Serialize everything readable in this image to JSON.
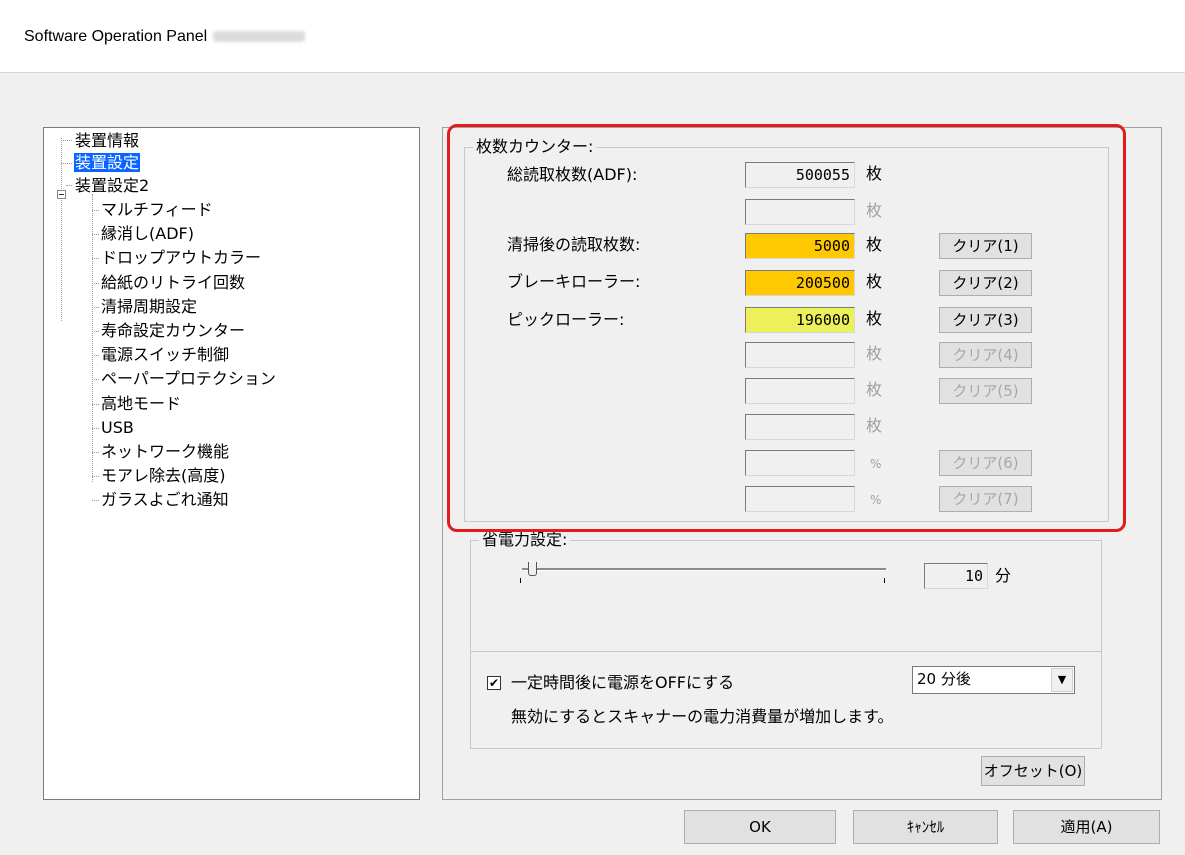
{
  "window": {
    "title": "Software Operation Panel"
  },
  "tree": {
    "items": [
      "装置情報",
      "装置設定",
      "装置設定2",
      "マルチフィード",
      "縁消し(ADF)",
      "ドロップアウトカラー",
      "給紙のリトライ回数",
      "清掃周期設定",
      "寿命設定カウンター",
      "電源スイッチ制御",
      "ペーパープロテクション",
      "高地モード",
      "USB",
      "ネットワーク機能",
      "モアレ除去(高度)",
      "ガラスよごれ通知"
    ],
    "selected": "装置設定"
  },
  "counter": {
    "group_title": "枚数カウンター:",
    "total_label": "総読取枚数(ADF):",
    "cleaning_label": "清掃後の読取枚数:",
    "brake_label": "ブレーキローラー:",
    "pick_label": "ピックローラー:",
    "values": [
      "500055",
      "",
      "5000",
      "200500",
      "196000",
      "",
      "",
      "",
      "",
      ""
    ],
    "units": [
      "枚",
      "枚",
      "枚",
      "枚",
      "枚",
      "枚",
      "枚",
      "枚",
      "%",
      "%"
    ],
    "clear_buttons": [
      "クリア(1)",
      "クリア(2)",
      "クリア(3)",
      "クリア(4)",
      "クリア(5)",
      "クリア(6)",
      "クリア(7)"
    ],
    "colors": {
      "cleaning": "#ffc800",
      "brake": "#ffc800",
      "pick": "#ecf05a"
    }
  },
  "power": {
    "group_title": "省電力設定:",
    "minutes": "10",
    "unit": "分",
    "auto_off_label": "一定時間後に電源をOFFにする",
    "auto_off_checked": true,
    "auto_off_value": "20 分後",
    "note": "無効にするとスキャナーの電力消費量が増加します。"
  },
  "buttons": {
    "offset": "オフセット(O)",
    "ok": "OK",
    "cancel": "ｷｬﾝｾﾙ",
    "apply": "適用(A)"
  },
  "accent": {
    "highlight": "#e41b1b",
    "selection": "#0a64ff"
  }
}
